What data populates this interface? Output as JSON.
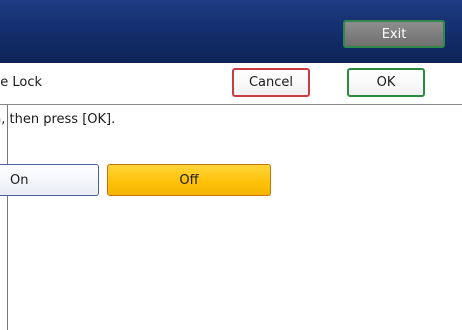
{
  "header": {
    "exit_label": "Exit"
  },
  "title_row": {
    "title": "de Lock",
    "cancel_label": "Cancel",
    "ok_label": "OK"
  },
  "content": {
    "instruction": "n, then press [OK].",
    "options": {
      "on_label": "On",
      "off_label": "Off",
      "selected": "Off"
    }
  },
  "colors": {
    "header_bg": "#15306f",
    "exit_bg": "#7a7a7a",
    "exit_border": "#2f8a4a",
    "cancel_border": "#cc3b42",
    "ok_border": "#2c8a3f",
    "selected_bg": "#ffc20a",
    "unselected_border": "#4a5ea0"
  }
}
